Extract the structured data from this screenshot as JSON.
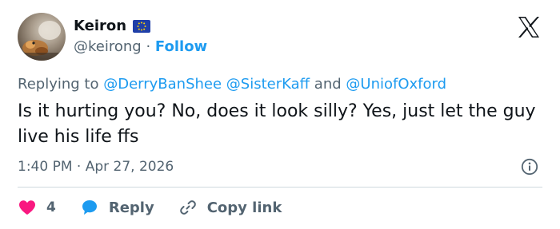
{
  "author": {
    "name": "Keiron",
    "handle": "@keirong",
    "separator": "·",
    "follow_label": "Follow",
    "flag_icon": "eu-flag-icon"
  },
  "brand": {
    "logo_icon": "x-logo-icon"
  },
  "reply_context": {
    "prefix": "Replying to",
    "mention_1": "@DerryBanShee",
    "mention_2": "@SisterKaff",
    "conjunction": "and",
    "mention_3": "@UniofOxford"
  },
  "tweet": {
    "text": "Is it hurting you? No, does it look silly? Yes, just let the guy live his life ffs"
  },
  "meta": {
    "time": "1:40 PM",
    "separator": "·",
    "date": "Apr 27, 2026",
    "info_icon": "info-icon"
  },
  "actions": {
    "like_count": "4",
    "reply_label": "Reply",
    "copy_label": "Copy link"
  },
  "colors": {
    "link": "#1d9bf0",
    "secondary_text": "#536471",
    "like": "#f91880",
    "eu_blue": "#1f3fa8",
    "eu_star": "#ffd200"
  }
}
